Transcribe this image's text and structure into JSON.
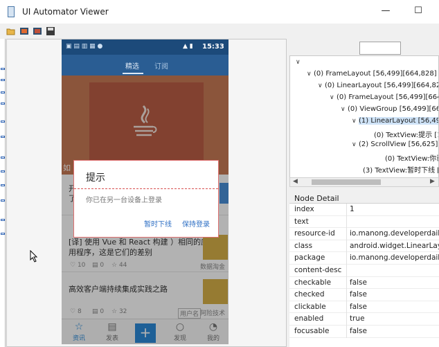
{
  "window": {
    "title": "UI Automator Viewer",
    "minimize": "—",
    "maximize": "☐"
  },
  "toolbar": {
    "icons": [
      "open-folder-icon",
      "device-screenshot-icon",
      "device-screenshot-compressed-icon",
      "save-icon"
    ]
  },
  "phone": {
    "status_time": "15:33",
    "tabs": [
      "精选",
      "订阅"
    ],
    "cards": [
      {
        "title_l1": "开",
        "title_l2": "了"
      },
      {
        "title_l1": "[译] 使用 Vue 和 React 构建 ）相同的应",
        "title_l2": "用程序，这是它们的差别",
        "likes": "10",
        "comments": "0",
        "stars": "44",
        "source": "数据淘金"
      },
      {
        "title_l1": "高效客户端持续集成实践之路",
        "likes": "8",
        "comments": "0",
        "stars": "32",
        "tag": "用户名",
        "source": "阿险技术"
      }
    ],
    "banner_label": "如",
    "nav": [
      "资讯",
      "发表",
      "",
      "发现",
      "我的"
    ],
    "nav_add": "+"
  },
  "dialog": {
    "title": "提示",
    "message": "你已在另一台设备上登录",
    "btn_later": "暂时下线",
    "btn_keep": "保持登录"
  },
  "tree": {
    "rows": [
      {
        "arrow": "∨",
        "text": ""
      },
      {
        "arrow": "∨",
        "text": "(0) FrameLayout [56,499][664,828]"
      },
      {
        "arrow": "∨",
        "text": "(0) LinearLayout [56,499][664,828"
      },
      {
        "arrow": "∨",
        "text": "(0) FrameLayout [56,499][664,"
      },
      {
        "arrow": "∨",
        "text": "(0) ViewGroup [56,499][664"
      },
      {
        "arrow": "∨",
        "text": "(1) LinearLayout [56,499"
      },
      {
        "arrow": "",
        "text": "(0) TextView:提示 [10"
      },
      {
        "arrow": "∨",
        "text": "(2) ScrollView [56,625]["
      },
      {
        "arrow": "",
        "text": "(0) TextView:你已在另"
      },
      {
        "arrow": "",
        "text": "(3) TextView:暂时下线 [3"
      }
    ]
  },
  "node_detail": {
    "header": "Node Detail",
    "rows": [
      {
        "key": "index",
        "value": "1"
      },
      {
        "key": "text",
        "value": ""
      },
      {
        "key": "resource-id",
        "value": "io.manong.developerdaily:"
      },
      {
        "key": "class",
        "value": "android.widget.LinearLayo"
      },
      {
        "key": "package",
        "value": "io.manong.developerdaily"
      },
      {
        "key": "content-desc",
        "value": ""
      },
      {
        "key": "checkable",
        "value": "false"
      },
      {
        "key": "checked",
        "value": "false"
      },
      {
        "key": "clickable",
        "value": "false"
      },
      {
        "key": "enabled",
        "value": "true"
      },
      {
        "key": "focusable",
        "value": "false"
      }
    ]
  }
}
